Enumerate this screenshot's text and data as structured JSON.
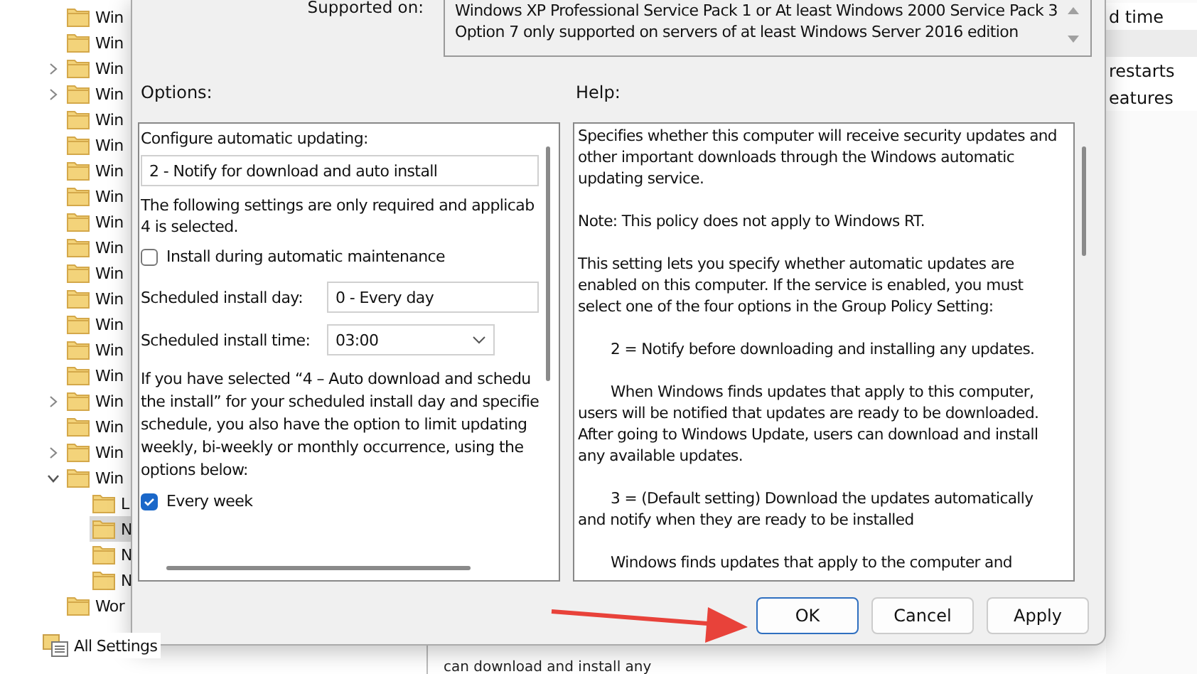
{
  "tree": [
    {
      "label": "Win",
      "kind": "leaf",
      "selected": false
    },
    {
      "label": "Win",
      "kind": "leaf",
      "selected": false
    },
    {
      "label": "Win",
      "kind": "branch",
      "expanded": false,
      "selected": false
    },
    {
      "label": "Win",
      "kind": "branch",
      "expanded": false,
      "selected": false
    },
    {
      "label": "Win",
      "kind": "leaf",
      "selected": false
    },
    {
      "label": "Win",
      "kind": "leaf",
      "selected": false
    },
    {
      "label": "Win",
      "kind": "leaf",
      "selected": false
    },
    {
      "label": "Win",
      "kind": "leaf",
      "selected": false
    },
    {
      "label": "Win",
      "kind": "leaf",
      "selected": false
    },
    {
      "label": "Win",
      "kind": "leaf",
      "selected": false
    },
    {
      "label": "Win",
      "kind": "leaf",
      "selected": false
    },
    {
      "label": "Win",
      "kind": "leaf",
      "selected": false
    },
    {
      "label": "Win",
      "kind": "leaf",
      "selected": false
    },
    {
      "label": "Win",
      "kind": "leaf",
      "selected": false
    },
    {
      "label": "Win",
      "kind": "leaf",
      "selected": false
    },
    {
      "label": "Win",
      "kind": "branch",
      "expanded": false,
      "selected": false
    },
    {
      "label": "Win",
      "kind": "leaf",
      "selected": false
    },
    {
      "label": "Win",
      "kind": "branch",
      "expanded": false,
      "selected": false
    },
    {
      "label": "Win",
      "kind": "branch",
      "expanded": true,
      "selected": false,
      "children": [
        {
          "label": "L",
          "kind": "leaf",
          "selected": false
        },
        {
          "label": "N",
          "kind": "leaf",
          "selected": true
        },
        {
          "label": "N",
          "kind": "leaf",
          "selected": false
        },
        {
          "label": "N",
          "kind": "leaf",
          "selected": false
        }
      ]
    },
    {
      "label": "Wor",
      "kind": "leaf",
      "selected": false
    },
    {
      "label": "All Settings",
      "kind": "settings",
      "selected": false
    }
  ],
  "right_list": [
    {
      "text": "d time",
      "selected": false
    },
    {
      "selected": true
    },
    {
      "text": "restarts",
      "selected": false
    },
    {
      "text": "eatures",
      "selected": false
    }
  ],
  "background_text": "can download and install any",
  "dialog": {
    "supported_label": "Supported on:",
    "supported_text": "Windows XP Professional Service Pack 1 or At least Windows 2000 Service Pack 3\nOption 7 only supported on servers of at least Windows Server 2016 edition",
    "options_label": "Options:",
    "help_label": "Help:",
    "options": {
      "configure_label": "Configure automatic updating:",
      "mode_value": "2 - Notify for download and auto install",
      "note": "The following settings are only required and applicab\n4 is selected.",
      "maintenance": {
        "label": "Install during automatic maintenance",
        "checked": false
      },
      "day": {
        "label": "Scheduled install day:",
        "value": "0 - Every day"
      },
      "time": {
        "label": "Scheduled install time:",
        "value": "03:00"
      },
      "description": "If you have selected “4 – Auto download and schedu\nthe install” for your scheduled install day and specifie\nschedule, you also have the option to limit updating\nweekly, bi-weekly or monthly occurrence, using the\noptions below:",
      "every_week": {
        "label": "Every week",
        "checked": true
      }
    },
    "help": [
      {
        "kind": "plain",
        "text": "Specifies whether this computer will receive security updates and\nother important downloads through the Windows automatic\nupdating service."
      },
      {
        "kind": "plain",
        "text": "Note: This policy does not apply to Windows RT."
      },
      {
        "kind": "plain",
        "text": "This setting lets you specify whether automatic updates are\nenabled on this computer. If the service is enabled, you must\nselect one of the four options in the Group Policy Setting:"
      },
      {
        "kind": "indented",
        "text": "2 = Notify before downloading and installing any updates."
      },
      {
        "kind": "indented",
        "text": "When Windows finds updates that apply to this computer,\nusers will be notified that updates are ready to be downloaded.\nAfter going to Windows Update, users can download and install\nany available updates."
      },
      {
        "kind": "indented",
        "text": "3 = (Default setting) Download the updates automatically\nand notify when they are ready to be installed"
      },
      {
        "kind": "indented",
        "text": "Windows finds updates that apply to the computer and"
      }
    ],
    "buttons": [
      {
        "label": "OK",
        "focused": true
      },
      {
        "label": "Cancel",
        "focused": false
      },
      {
        "label": "Apply",
        "focused": false
      }
    ]
  }
}
